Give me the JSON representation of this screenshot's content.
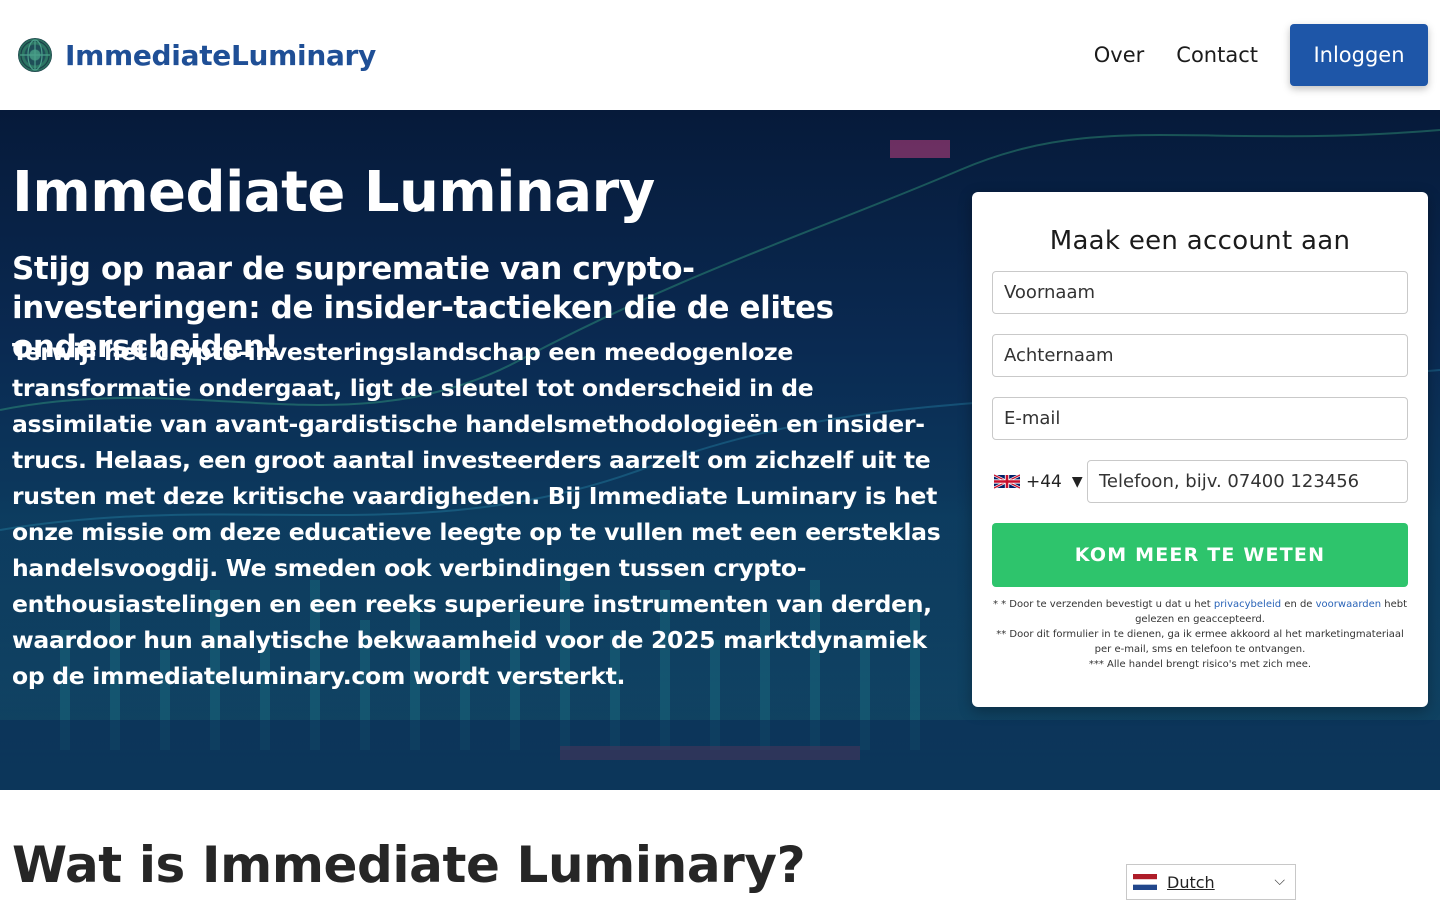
{
  "header": {
    "logo_text": "ImmediateLuminary",
    "nav": [
      "Over",
      "Contact"
    ],
    "login_label": "Inloggen"
  },
  "hero": {
    "title": "Immediate Luminary",
    "subtitle": "Stijg op naar de suprematie van crypto-investeringen: de insider-tactieken die de elites onderscheiden!",
    "body": "Terwijl het crypto-investeringslandschap een meedogenloze transformatie ondergaat, ligt de sleutel tot onderscheid in de assimilatie van avant-gardistische handelsmethodologieën en insider-trucs. Helaas, een groot aantal investeerders aarzelt om zichzelf uit te rusten met deze kritische vaardigheden. Bij Immediate Luminary is het onze missie om deze educatieve leegte op te vullen met een eersteklas handelsvoogdij. We smeden ook verbindingen tussen crypto-enthousiastelingen en een reeks superieure instrumenten van derden, waardoor hun analytische bekwaamheid voor de 2025 marktdynamiek op de immediateluminary.com wordt versterkt."
  },
  "form": {
    "title": "Maak een account aan",
    "first_name_placeholder": "Voornaam",
    "last_name_placeholder": "Achternaam",
    "email_placeholder": "E-mail",
    "country_code": "+44",
    "phone_placeholder": "Telefoon, bijv.  07400 123456",
    "submit_label": "KOM MEER TE WETEN",
    "disclaimer": {
      "line1_pre": "* * Door te verzenden bevestigt u dat u het ",
      "privacy_link": "privacybeleid",
      "line1_mid": " en de ",
      "terms_link": "voorwaarden",
      "line1_post": " hebt gelezen en geaccepteerd.",
      "line2": "** Door dit formulier in te dienen, ga ik ermee akkoord al het marketingmateriaal per e-mail, sms en telefoon te ontvangen.",
      "line3": "*** Alle handel brengt risico's met zich mee."
    }
  },
  "section": {
    "title": "Wat is Immediate Luminary?"
  },
  "language": {
    "selected": "Dutch"
  },
  "colors": {
    "brand_blue": "#1e56a8",
    "cta_green": "#2ec46c",
    "link_blue": "#2a64b8"
  },
  "icons": [
    "globe-logo-icon",
    "uk-flag-icon",
    "nl-flag-icon",
    "chevron-down-icon"
  ]
}
